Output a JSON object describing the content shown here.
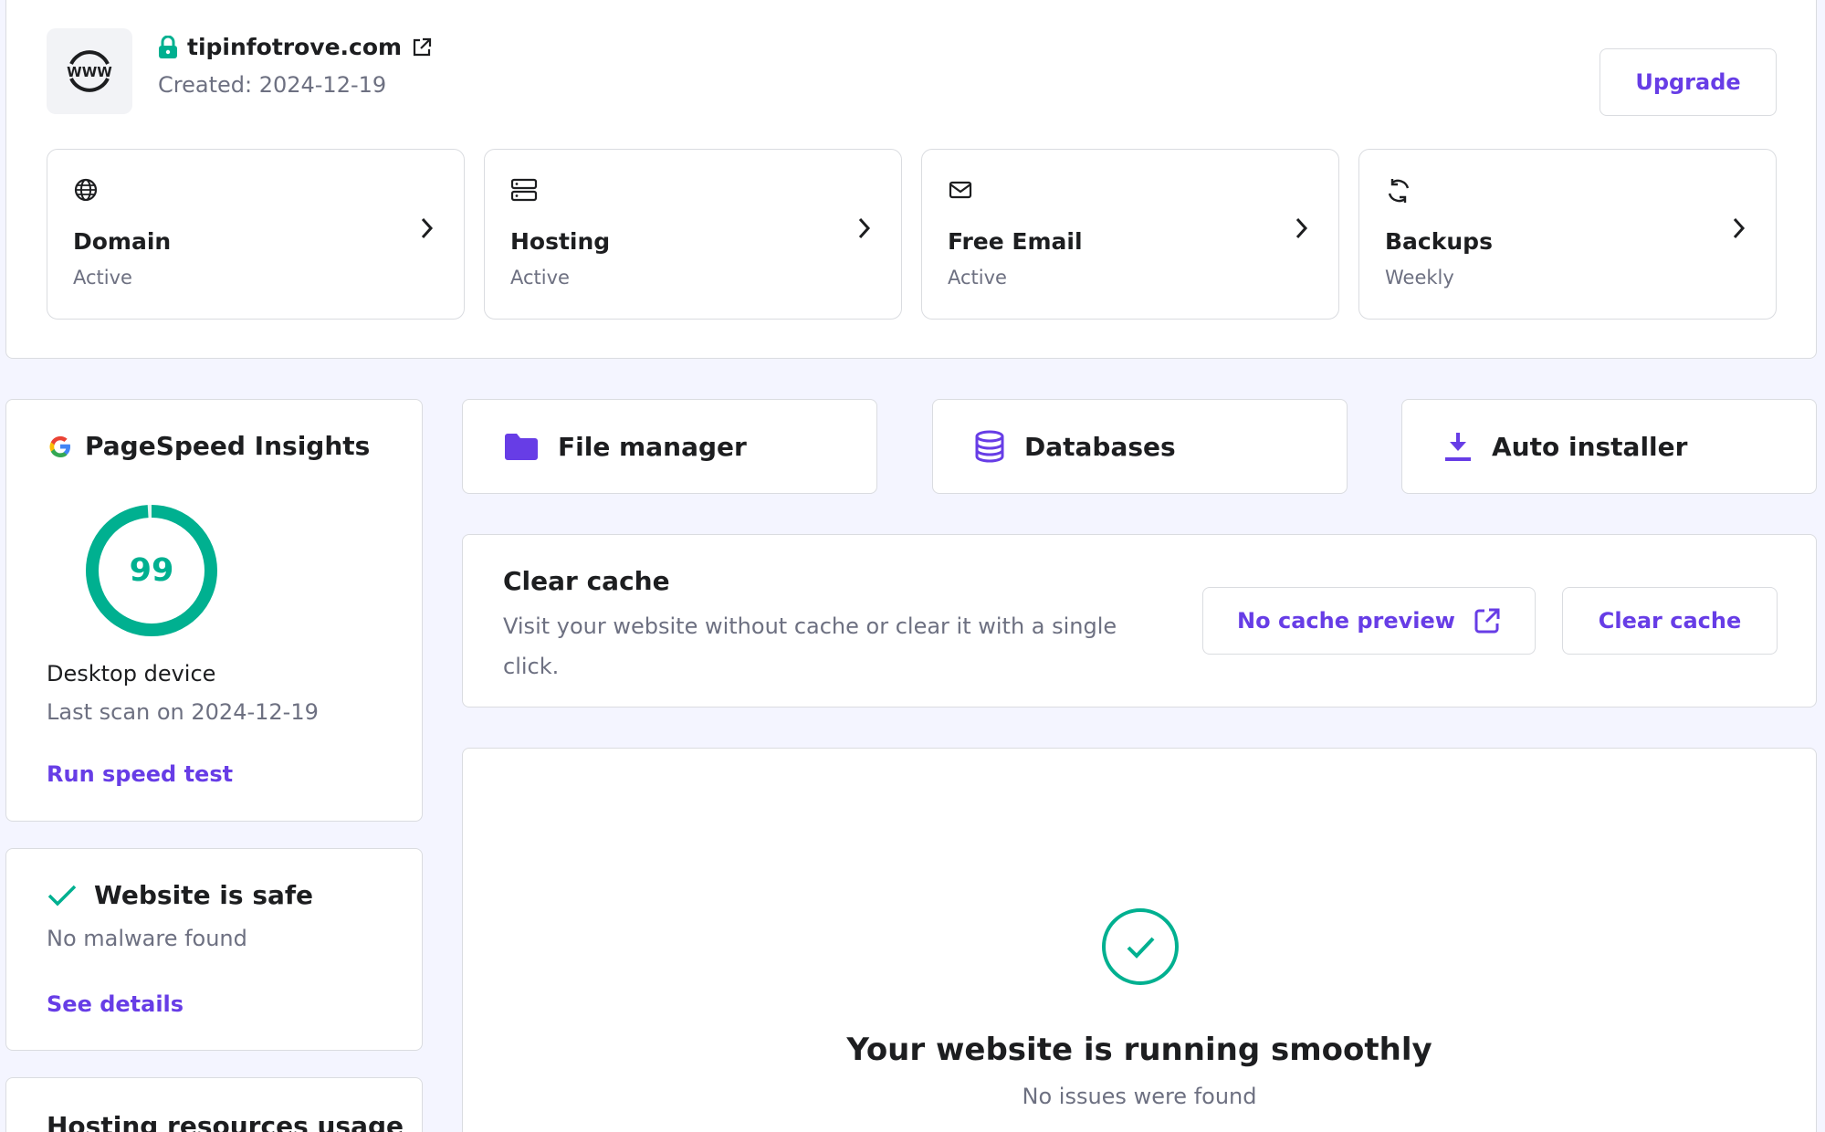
{
  "site": {
    "logo_text": "WWW",
    "domain": "tipinfotrove.com",
    "created": "Created: 2024-12-19",
    "upgrade_label": "Upgrade"
  },
  "tiles": [
    {
      "title": "Domain",
      "status": "Active",
      "icon": "globe-icon"
    },
    {
      "title": "Hosting",
      "status": "Active",
      "icon": "server-icon"
    },
    {
      "title": "Free Email",
      "status": "Active",
      "icon": "mail-icon"
    },
    {
      "title": "Backups",
      "status": "Weekly",
      "icon": "sync-icon"
    }
  ],
  "pagespeed": {
    "title": "PageSpeed Insights",
    "score": "99",
    "score_fraction": 0.99,
    "device": "Desktop device",
    "last_scan": "Last scan on 2024-12-19",
    "run_label": "Run speed test"
  },
  "security": {
    "title": "Website is safe",
    "subtitle": "No malware found",
    "link_label": "See details"
  },
  "resources": {
    "title": "Hosting resources usage"
  },
  "quick_links": [
    {
      "label": "File manager",
      "icon": "folder-icon"
    },
    {
      "label": "Databases",
      "icon": "database-icon"
    },
    {
      "label": "Auto installer",
      "icon": "download-icon"
    }
  ],
  "cache": {
    "title": "Clear cache",
    "description": "Visit your website without cache or clear it with a single click.",
    "preview_label": "No cache preview",
    "clear_label": "Clear cache"
  },
  "status": {
    "title": "Your website is running smoothly",
    "subtitle": "No issues were found"
  },
  "colors": {
    "accent": "#673de6",
    "success": "#00b090",
    "background": "#f4f5ff"
  }
}
